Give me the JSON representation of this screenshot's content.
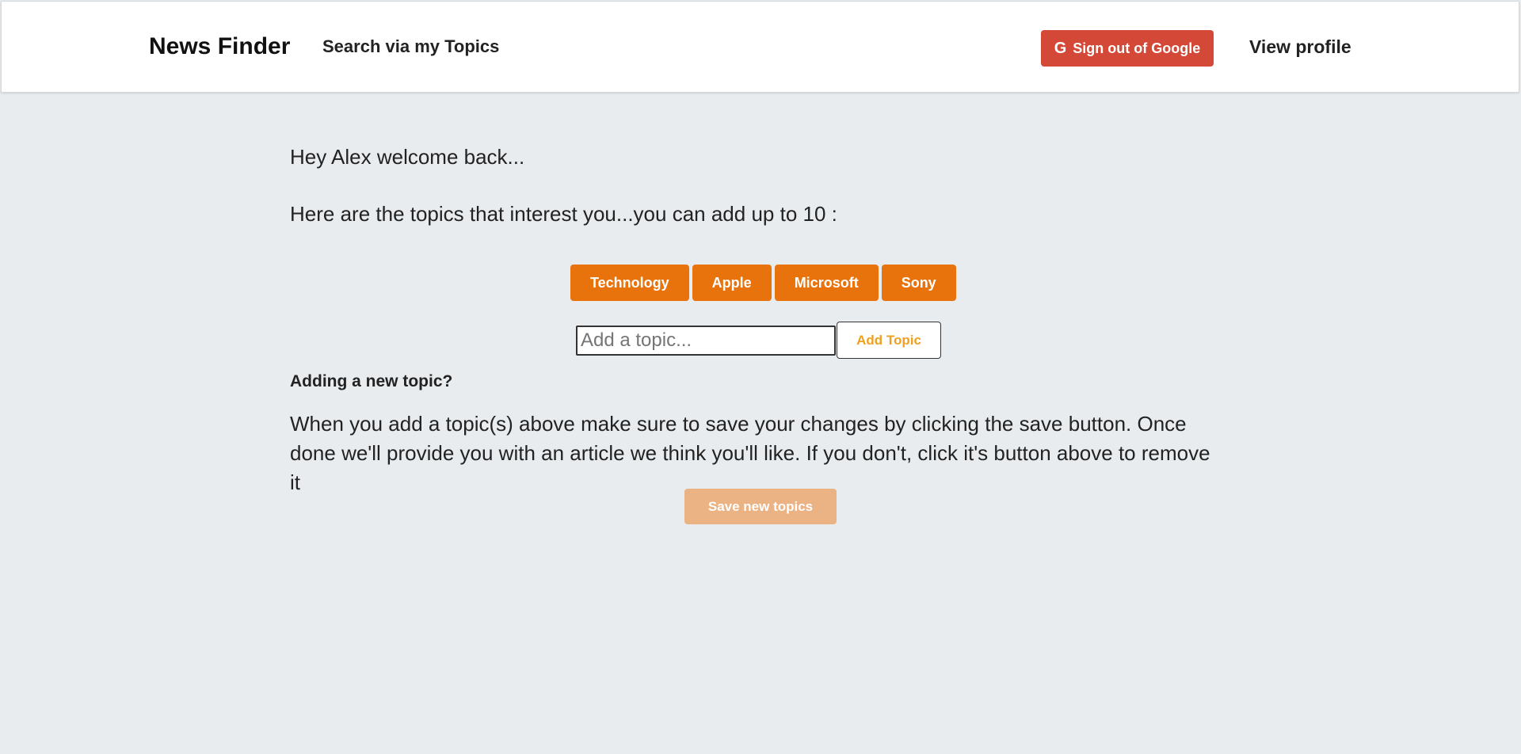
{
  "navbar": {
    "brand": "News Finder",
    "search_link": "Search via my Topics",
    "sign_out_label": "Sign out of Google",
    "sign_out_icon": "google-g-icon",
    "view_profile": "View profile"
  },
  "main": {
    "welcome": "Hey Alex welcome back...",
    "topics_intro": "Here are the topics that interest you...you can add up to 10 :",
    "topics": [
      "Technology",
      "Apple",
      "Microsoft",
      "Sony"
    ],
    "add_input_placeholder": "Add a topic...",
    "add_input_value": "",
    "add_button_label": "Add Topic",
    "help_heading": "Adding a new topic?",
    "help_text": "When you add a topic(s) above make sure to save your changes by clicking the save button. Once done we'll provide you with an article we think you'll like. If you don't, click it's button above to remove it",
    "save_button_label": "Save new topics",
    "save_button_disabled": true
  },
  "colors": {
    "background": "#e9ecef",
    "navbar_bg": "#ffffff",
    "google_red": "#d34836",
    "topic_orange": "#e8730c",
    "add_button_text": "#f0a020",
    "save_disabled": "#ebb283"
  }
}
